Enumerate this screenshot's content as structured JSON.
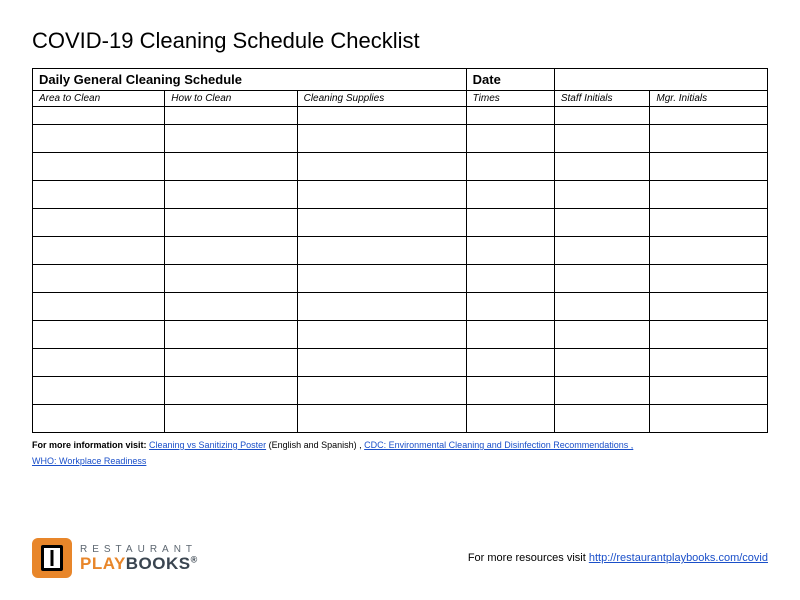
{
  "title": "COVID-19 Cleaning Schedule Checklist",
  "table": {
    "header_left": "Daily General Cleaning Schedule",
    "header_right": "Date",
    "columns": [
      "Area to Clean",
      "How to Clean",
      "Cleaning Supplies",
      "Times",
      "Staff Initials",
      "Mgr. Initials"
    ],
    "row_count": 12
  },
  "info": {
    "prefix": "For more information visit:",
    "link1": "Cleaning vs Sanitizing Poster",
    "link1_suffix": " (English and Spanish) , ",
    "link2": "CDC: Environmental Cleaning and Disinfection Recommendations ,",
    "link3": "WHO: Workplace Readiness"
  },
  "logo": {
    "top": "RESTAURANT",
    "bottom_play": "PLAY",
    "bottom_books": "BOOKS",
    "reg": "®"
  },
  "footer": {
    "text": "For more resources visit ",
    "link": "http://restaurantplaybooks.com/covid"
  }
}
